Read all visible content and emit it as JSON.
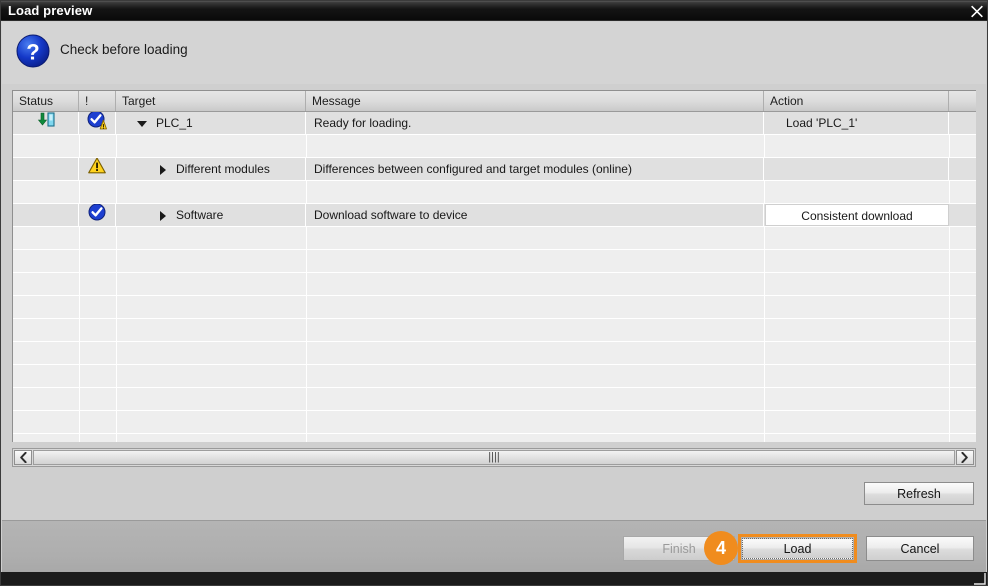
{
  "window": {
    "title": "Load preview",
    "close_icon": "close-icon"
  },
  "header": {
    "icon": "question-help-icon",
    "label": "Check before loading"
  },
  "table": {
    "columns": [
      {
        "key": "status",
        "label": "Status"
      },
      {
        "key": "alert",
        "label": "!"
      },
      {
        "key": "target",
        "label": "Target"
      },
      {
        "key": "message",
        "label": "Message"
      },
      {
        "key": "action",
        "label": "Action"
      },
      {
        "key": "spacer",
        "label": ""
      }
    ],
    "rows": [
      {
        "status_icon": "download-to-device-icon",
        "alert_icon": "check-warning-badge-icon",
        "expander": "triangle-down",
        "target": "PLC_1",
        "message": "Ready for loading.",
        "action": "Load 'PLC_1'",
        "action_editable": false,
        "indent": 0
      },
      {
        "status_icon": "",
        "alert_icon": "warning-triangle-icon",
        "expander": "triangle-right",
        "target": "Different modules",
        "message": "Differences between configured and target modules (online)",
        "action": "",
        "action_editable": false,
        "indent": 1
      },
      {
        "status_icon": "",
        "alert_icon": "check-circle-icon",
        "expander": "triangle-right",
        "target": "Software",
        "message": "Download software to device",
        "action": "Consistent download",
        "action_editable": true,
        "indent": 1
      }
    ],
    "empty_row_count": 11
  },
  "scrollbar": {
    "left_arrow": "chevron-left-icon",
    "right_arrow": "chevron-right-icon",
    "grip": "||||"
  },
  "buttons": {
    "refresh": "Refresh",
    "finish": "Finish",
    "load": "Load",
    "cancel": "Cancel"
  },
  "annotation": {
    "step_number": "4",
    "accent_color": "#f08c1e"
  },
  "colors": {
    "titlebar": "#141414",
    "body": "#cfcfcf",
    "footer": "#aeaeae",
    "row_shade": "#e0e0e0",
    "row_base": "#eeeeee",
    "check_blue": "#1d3fd0",
    "warn_yellow": "#ffd21e",
    "download_green": "#1e8a3c"
  }
}
